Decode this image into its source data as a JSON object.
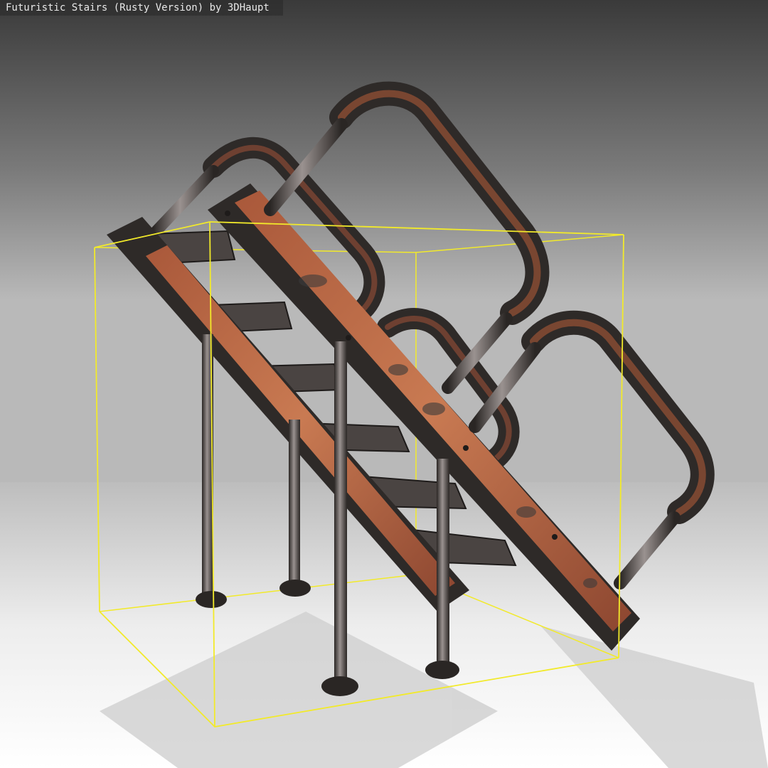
{
  "viewer": {
    "title": "Futuristic Stairs (Rusty Version) by 3DHaupt"
  },
  "scene": {
    "object": "futuristic-rusty-stairs",
    "bounding_box_color": "#f2ea2a",
    "material_colors": {
      "rust": "#b0623f",
      "dark_metal": "#2e2a28",
      "steel": "#8a8480"
    }
  }
}
